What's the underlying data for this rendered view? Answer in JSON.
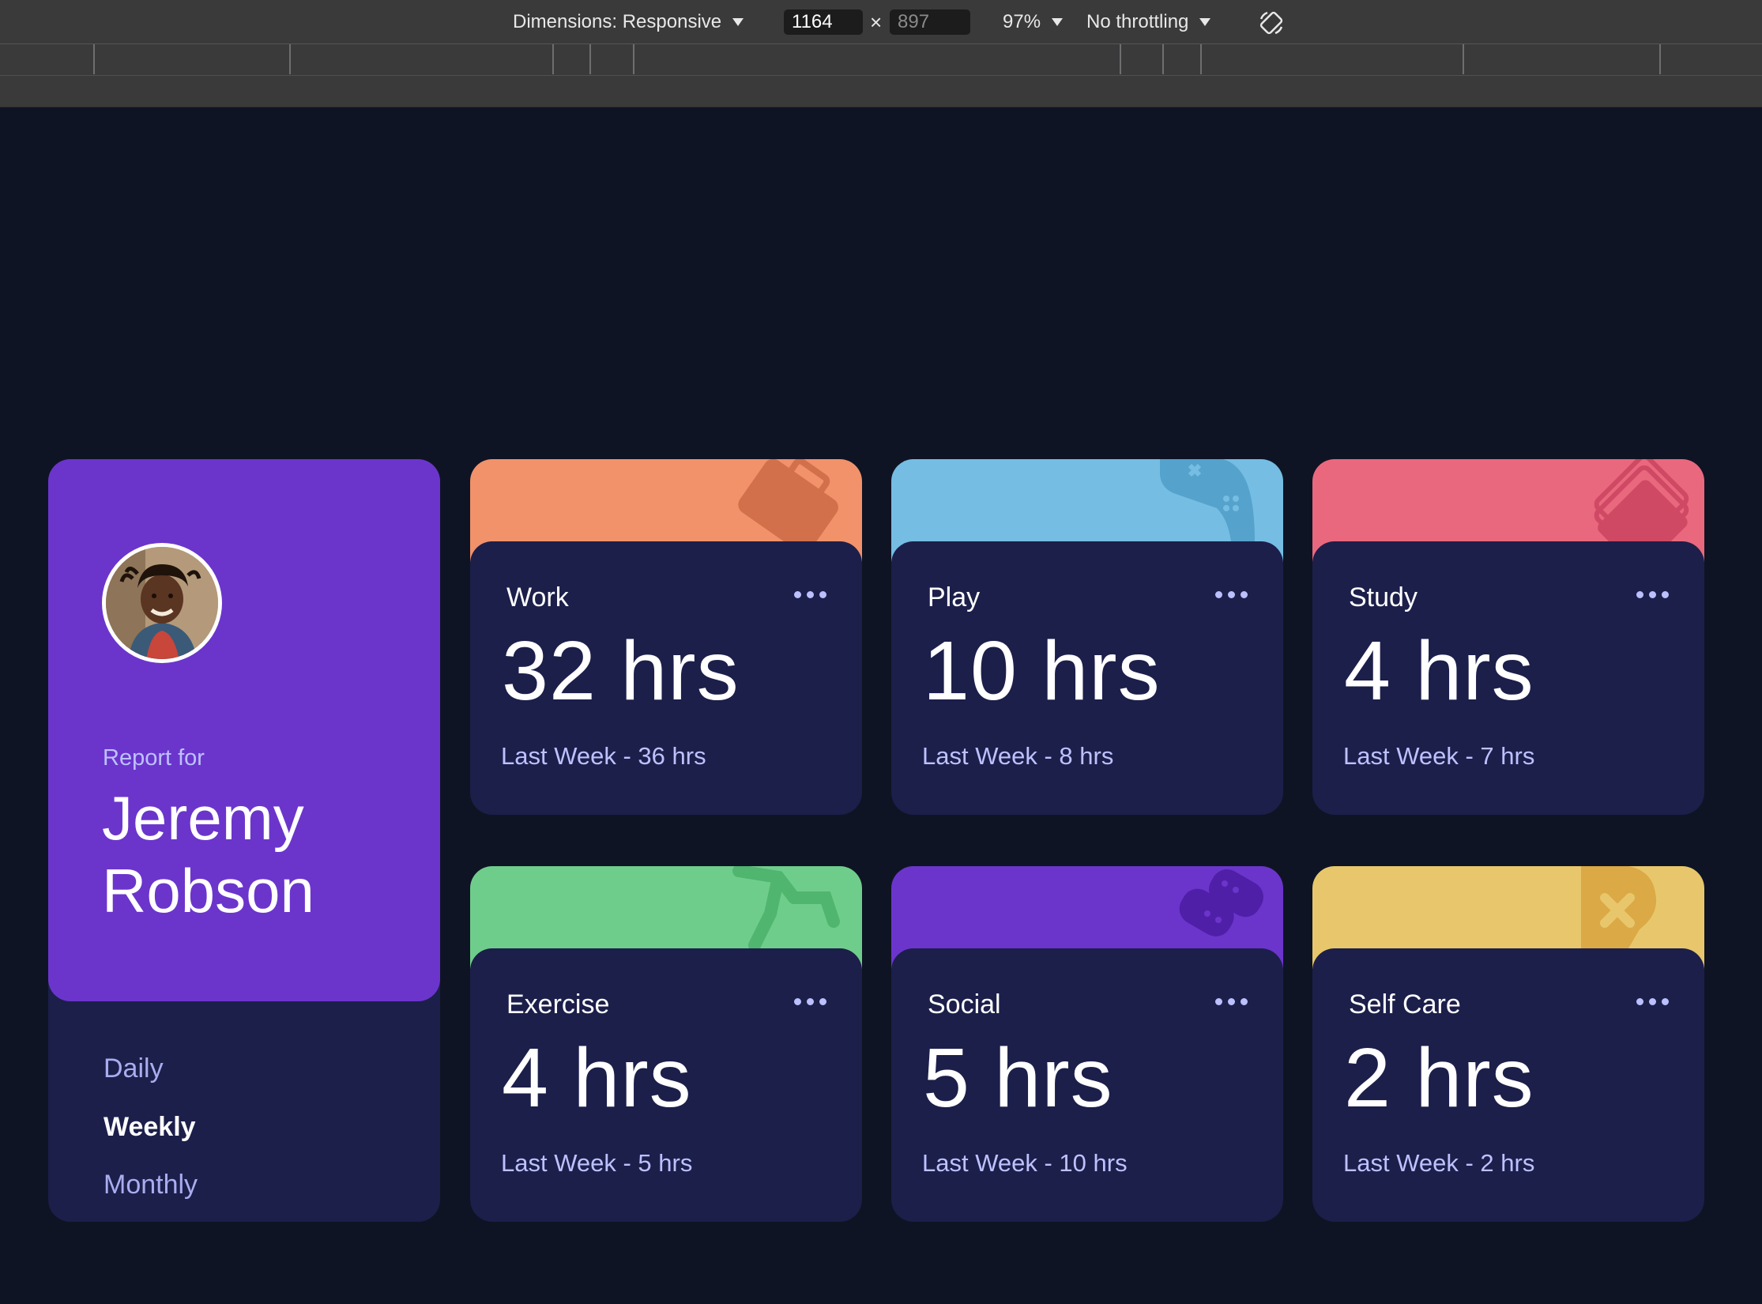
{
  "devtools": {
    "dimensions_label": "Dimensions: Responsive",
    "width": "1164",
    "times": "×",
    "height": "897",
    "zoom": "97%",
    "throttling": "No throttling"
  },
  "profile": {
    "report_for": "Report for",
    "name": "Jeremy Robson",
    "periods": [
      "Daily",
      "Weekly",
      "Monthly"
    ],
    "active_period": "Weekly"
  },
  "cards": [
    {
      "title": "Work",
      "hours": "32 hrs",
      "last": "Last Week - 36 hrs",
      "color": "#f1926b",
      "icon": "briefcase-icon"
    },
    {
      "title": "Play",
      "hours": "10 hrs",
      "last": "Last Week - 8 hrs",
      "color": "#75bde3",
      "icon": "gamepad-icon"
    },
    {
      "title": "Study",
      "hours": "4 hrs",
      "last": "Last Week - 7 hrs",
      "color": "#ea687e",
      "icon": "book-icon"
    },
    {
      "title": "Exercise",
      "hours": "4 hrs",
      "last": "Last Week - 5 hrs",
      "color": "#6fcd8b",
      "icon": "runner-icon"
    },
    {
      "title": "Social",
      "hours": "5 hrs",
      "last": "Last Week - 10 hrs",
      "color": "#6b35cc",
      "icon": "chat-icon"
    },
    {
      "title": "Self Care",
      "hours": "2 hrs",
      "last": "Last Week - 2 hrs",
      "color": "#e8c76c",
      "icon": "heart-icon"
    }
  ],
  "colors": {
    "background": "#0f1424",
    "card": "#1c1f4a",
    "profile": "#6b35cc",
    "muted_text": "#bdc1ff"
  }
}
